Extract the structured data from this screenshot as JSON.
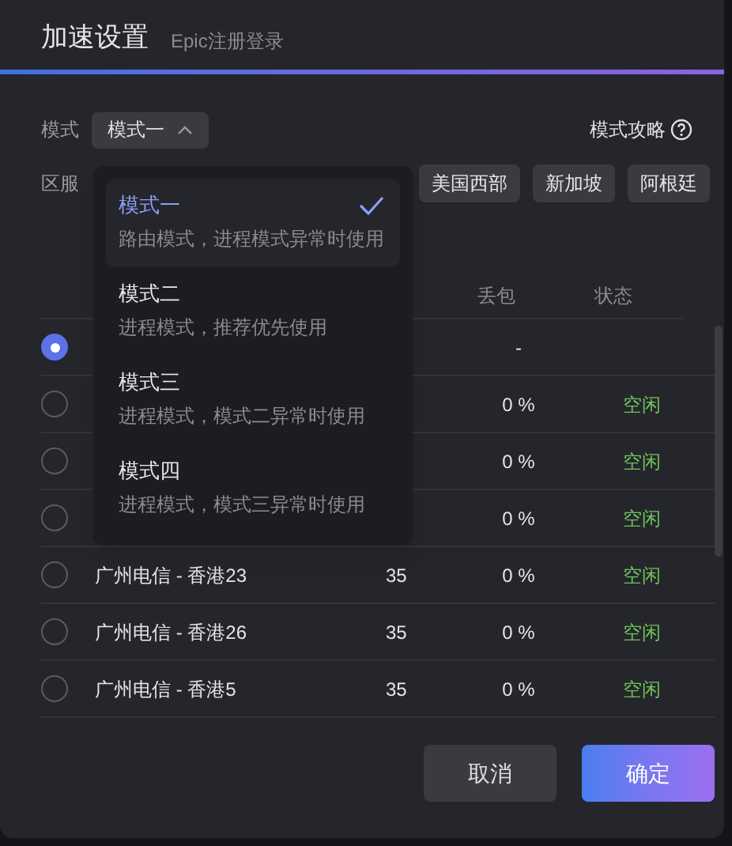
{
  "dialog": {
    "title": "加速设置",
    "subtitle": "Epic注册登录"
  },
  "mode": {
    "label": "模式",
    "value": "模式一",
    "expanded": true
  },
  "guide": {
    "label": "模式攻略"
  },
  "region": {
    "label": "区服",
    "chips": [
      {
        "label": "美国西部"
      },
      {
        "label": "新加坡"
      },
      {
        "label": "阿根廷"
      }
    ]
  },
  "table": {
    "columns": [
      "丢包",
      "状态"
    ],
    "rows": [
      {
        "selected": true,
        "loss": "-"
      },
      {
        "selected": false,
        "loss": "0 %",
        "status": "空闲"
      },
      {
        "selected": false,
        "loss": "0 %",
        "status": "空闲"
      },
      {
        "selected": false,
        "loss": "0 %",
        "status": "空闲"
      },
      {
        "selected": false,
        "name": "广州电信 - 香港23",
        "latency": "35",
        "loss": "0 %",
        "status": "空闲"
      },
      {
        "selected": false,
        "name": "广州电信 - 香港26",
        "latency": "35",
        "loss": "0 %",
        "status": "空闲"
      },
      {
        "selected": false,
        "name": "广州电信 - 香港5",
        "latency": "35",
        "loss": "0 %",
        "status": "空闲"
      }
    ]
  },
  "mode_menu": {
    "items": [
      {
        "title": "模式一",
        "description": "路由模式，进程模式异常时使用",
        "selected": true
      },
      {
        "title": "模式二",
        "description": "进程模式，推荐优先使用",
        "selected": false
      },
      {
        "title": "模式三",
        "description": "进程模式，模式二异常时使用",
        "selected": false
      },
      {
        "title": "模式四",
        "description": "进程模式，模式三异常时使用",
        "selected": false
      }
    ]
  },
  "buttons": [
    {
      "label": "取消",
      "kind": "secondary"
    },
    {
      "label": "确定",
      "kind": "primary"
    }
  ]
}
